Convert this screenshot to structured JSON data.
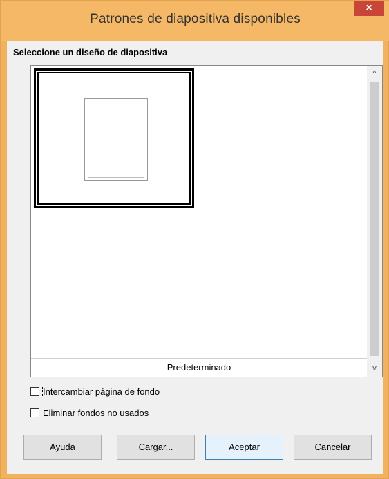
{
  "window": {
    "title": "Patrones de diapositiva disponibles",
    "close_glyph": "×"
  },
  "heading": "Seleccione un diseño de diapositiva",
  "list": {
    "items": [
      {
        "label": "Predeterminado",
        "selected": true
      }
    ],
    "scroll_up_glyph": "^",
    "scroll_down_glyph": "v"
  },
  "options": {
    "swap_background": {
      "label": "Intercambiar página de fondo",
      "checked": false
    },
    "delete_unused": {
      "label": "Eliminar fondos no usados",
      "checked": false
    }
  },
  "buttons": {
    "help": "Ayuda",
    "load": "Cargar...",
    "ok": "Aceptar",
    "cancel": "Cancelar"
  },
  "colors": {
    "title_bar": "#f5b867",
    "close_button": "#c84638",
    "default_button_border": "#3c7fb1"
  }
}
